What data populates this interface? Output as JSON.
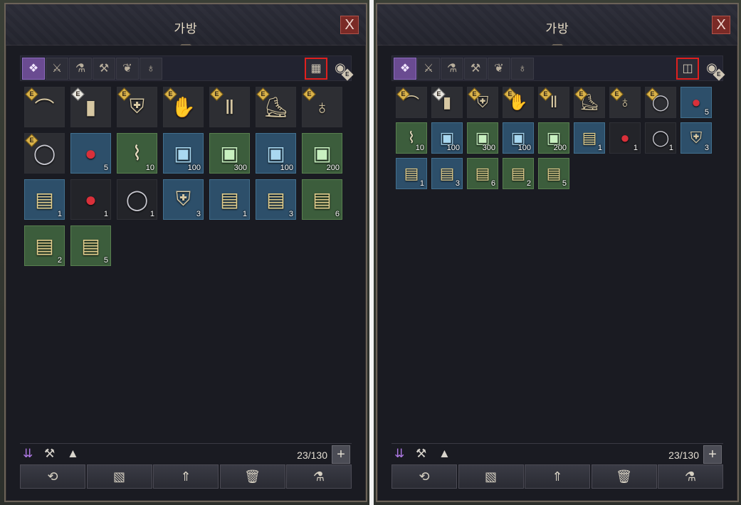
{
  "left_panel": {
    "title": "가방",
    "close_label": "X",
    "tabs": [
      {
        "icon": "all-items-icon",
        "glyph": "❖",
        "active": true
      },
      {
        "icon": "equipment-icon",
        "glyph": "⚔",
        "active": false
      },
      {
        "icon": "potion-icon",
        "glyph": "⚗",
        "active": false
      },
      {
        "icon": "anvil-icon",
        "glyph": "⚒",
        "active": false
      },
      {
        "icon": "leaf-icon",
        "glyph": "❦",
        "active": false
      },
      {
        "icon": "pouch-icon",
        "glyph": "♁",
        "active": false
      }
    ],
    "view_toggle_glyph": "▦",
    "eye_glyph": "◉",
    "eye_badge": "E",
    "items": [
      {
        "icon": "bow-icon",
        "glyph": "⌒",
        "style": "gray",
        "badge": "E",
        "badge_style": "gold",
        "qty": ""
      },
      {
        "icon": "greatsword-icon",
        "glyph": "▮",
        "style": "gray",
        "badge": "E",
        "badge_style": "white",
        "qty": ""
      },
      {
        "icon": "robe-icon",
        "glyph": "⛨",
        "style": "gray",
        "badge": "E",
        "badge_style": "gold",
        "qty": ""
      },
      {
        "icon": "gloves-icon",
        "glyph": "✋",
        "style": "gray",
        "badge": "E",
        "badge_style": "gold",
        "qty": ""
      },
      {
        "icon": "pants-icon",
        "glyph": "Ⅱ",
        "style": "gray",
        "badge": "E",
        "badge_style": "gold",
        "qty": ""
      },
      {
        "icon": "boots-icon",
        "glyph": "⛸",
        "style": "gray",
        "badge": "E",
        "badge_style": "gold",
        "qty": ""
      },
      {
        "icon": "earrings-icon",
        "glyph": "♁",
        "style": "gray",
        "badge": "E",
        "badge_style": "gold",
        "qty": ""
      },
      {
        "icon": "ring-icon",
        "glyph": "◯",
        "style": "gray",
        "badge": "E",
        "badge_style": "gold",
        "qty": "",
        "cls": "ring"
      },
      {
        "icon": "berries-icon",
        "glyph": "●",
        "style": "blue",
        "badge": "",
        "qty": "5",
        "cls": "berry"
      },
      {
        "icon": "scroll-icon",
        "glyph": "⌇",
        "style": "green",
        "badge": "",
        "qty": "10",
        "cls": "scroll"
      },
      {
        "icon": "blue-book-icon",
        "glyph": "▣",
        "style": "blue",
        "badge": "",
        "qty": "100",
        "cls": "book-blue"
      },
      {
        "icon": "green-book-icon",
        "glyph": "▣",
        "style": "green",
        "badge": "",
        "qty": "300",
        "cls": "book-green"
      },
      {
        "icon": "blue-book-icon",
        "glyph": "▣",
        "style": "blue",
        "badge": "",
        "qty": "100",
        "cls": "book-blue"
      },
      {
        "icon": "green-book-icon",
        "glyph": "▣",
        "style": "green",
        "badge": "",
        "qty": "200",
        "cls": "book-green"
      },
      {
        "icon": "chest-icon",
        "glyph": "▤",
        "style": "blue",
        "badge": "",
        "qty": "1",
        "cls": "chest"
      },
      {
        "icon": "berries-icon",
        "glyph": "●",
        "style": "dark",
        "badge": "",
        "qty": "1",
        "cls": "berry"
      },
      {
        "icon": "ring-icon",
        "glyph": "◯",
        "style": "dark",
        "badge": "",
        "qty": "1",
        "cls": "ring"
      },
      {
        "icon": "armor-set-icon",
        "glyph": "⛨",
        "style": "blue",
        "badge": "",
        "qty": "3"
      },
      {
        "icon": "weapon-chest-icon",
        "glyph": "▤",
        "style": "blue",
        "badge": "",
        "qty": "1",
        "cls": "chest"
      },
      {
        "icon": "chest-icon",
        "glyph": "▤",
        "style": "blue",
        "badge": "",
        "qty": "3",
        "cls": "chest"
      },
      {
        "icon": "green-chest-icon",
        "glyph": "▤",
        "style": "green",
        "badge": "",
        "qty": "6",
        "cls": "chest"
      },
      {
        "icon": "green-chest-icon",
        "glyph": "▤",
        "style": "green",
        "badge": "",
        "qty": "2",
        "cls": "chest"
      },
      {
        "icon": "green-chest-icon",
        "glyph": "▤",
        "style": "green",
        "badge": "",
        "qty": "5",
        "cls": "chest"
      }
    ],
    "count": "23/130",
    "plus_label": "+",
    "sort_glyph": "⇊",
    "anvil_glyph": "⚒",
    "pile_glyph": "▲",
    "actions": [
      {
        "icon": "refine-icon",
        "glyph": "⟲"
      },
      {
        "icon": "map-icon",
        "glyph": "▧"
      },
      {
        "icon": "upgrade-icon",
        "glyph": "⇑"
      },
      {
        "icon": "trash-icon",
        "glyph": "🗑"
      },
      {
        "icon": "alchemy-icon",
        "glyph": "⚗"
      }
    ]
  },
  "right_panel": {
    "title": "가방",
    "close_label": "X",
    "view_toggle_glyph": "◫",
    "eye_glyph": "◉",
    "eye_badge": "E",
    "count": "23/130",
    "plus_label": "+"
  }
}
